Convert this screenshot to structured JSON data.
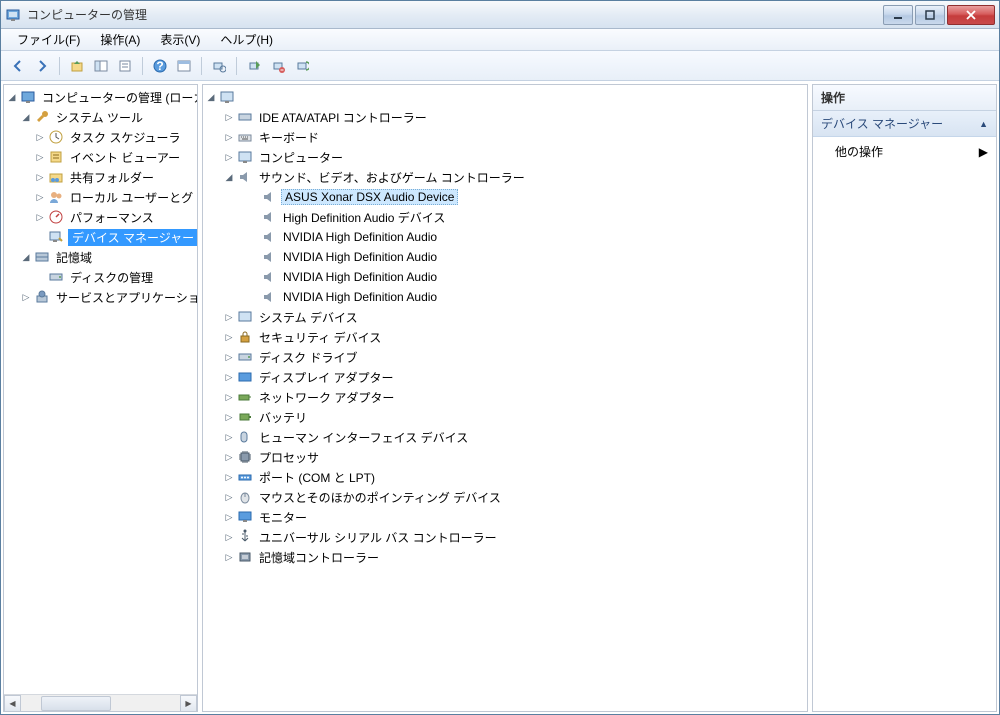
{
  "title": "コンピューターの管理",
  "menu": {
    "file": "ファイル(F)",
    "action": "操作(A)",
    "view": "表示(V)",
    "help": "ヘルプ(H)"
  },
  "left_tree": {
    "root": "コンピューターの管理 (ローカル)",
    "system_tools": "システム ツール",
    "task_scheduler": "タスク スケジューラ",
    "event_viewer": "イベント ビューアー",
    "shared_folders": "共有フォルダー",
    "local_users": "ローカル ユーザーとグ",
    "performance": "パフォーマンス",
    "device_manager": "デバイス マネージャー",
    "storage": "記憶域",
    "disk_mgmt": "ディスクの管理",
    "services": "サービスとアプリケーショ"
  },
  "center_tree": {
    "ide": "IDE ATA/ATAPI コントローラー",
    "keyboard": "キーボード",
    "computer": "コンピューター",
    "sound": "サウンド、ビデオ、およびゲーム コントローラー",
    "asus": "ASUS Xonar DSX Audio Device",
    "hda": "High Definition Audio デバイス",
    "nvidia1": "NVIDIA High Definition Audio",
    "nvidia2": "NVIDIA High Definition Audio",
    "nvidia3": "NVIDIA High Definition Audio",
    "nvidia4": "NVIDIA High Definition Audio",
    "system_devices": "システム デバイス",
    "security": "セキュリティ デバイス",
    "disk_drives": "ディスク ドライブ",
    "display": "ディスプレイ アダプター",
    "network": "ネットワーク アダプター",
    "battery": "バッテリ",
    "hid": "ヒューマン インターフェイス デバイス",
    "processor": "プロセッサ",
    "ports": "ポート (COM と LPT)",
    "mouse": "マウスとそのほかのポインティング デバイス",
    "monitor": "モニター",
    "usb": "ユニバーサル シリアル バス コントローラー",
    "storage_ctrl": "記憶域コントローラー"
  },
  "right": {
    "header": "操作",
    "section": "デバイス マネージャー",
    "other": "他の操作"
  }
}
